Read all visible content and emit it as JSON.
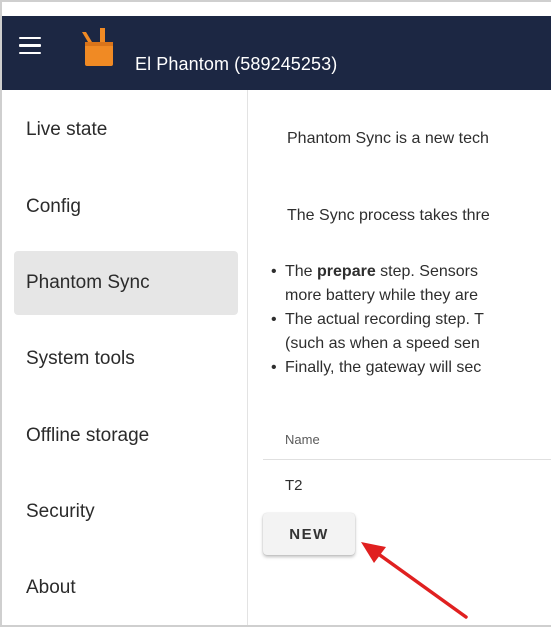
{
  "app": {
    "title": "El Phantom (589245253)",
    "header_bg": "#1c2743",
    "logo_color": "#f08a24"
  },
  "sidebar": {
    "items": [
      {
        "label": "Live state",
        "active": false
      },
      {
        "label": "Config",
        "active": false
      },
      {
        "label": "Phantom Sync",
        "active": true
      },
      {
        "label": "System tools",
        "active": false
      },
      {
        "label": "Offline storage",
        "active": false
      },
      {
        "label": "Security",
        "active": false
      },
      {
        "label": "About",
        "active": false
      }
    ]
  },
  "main": {
    "intro": "Phantom Sync is a new tech",
    "process_intro": "The Sync process takes thre",
    "steps": [
      {
        "prefix": "The ",
        "bold": "prepare",
        "rest": " step. Sensors",
        "line2": "more battery while they are"
      },
      {
        "text": "The actual recording step. T",
        "line2": "(such as when a speed sen"
      },
      {
        "text": "Finally, the gateway will sec"
      }
    ],
    "table": {
      "columns": [
        "Name"
      ],
      "rows": [
        [
          "T2"
        ]
      ]
    },
    "new_button": "NEW"
  },
  "annotation": {
    "arrow_color": "#e02020"
  }
}
